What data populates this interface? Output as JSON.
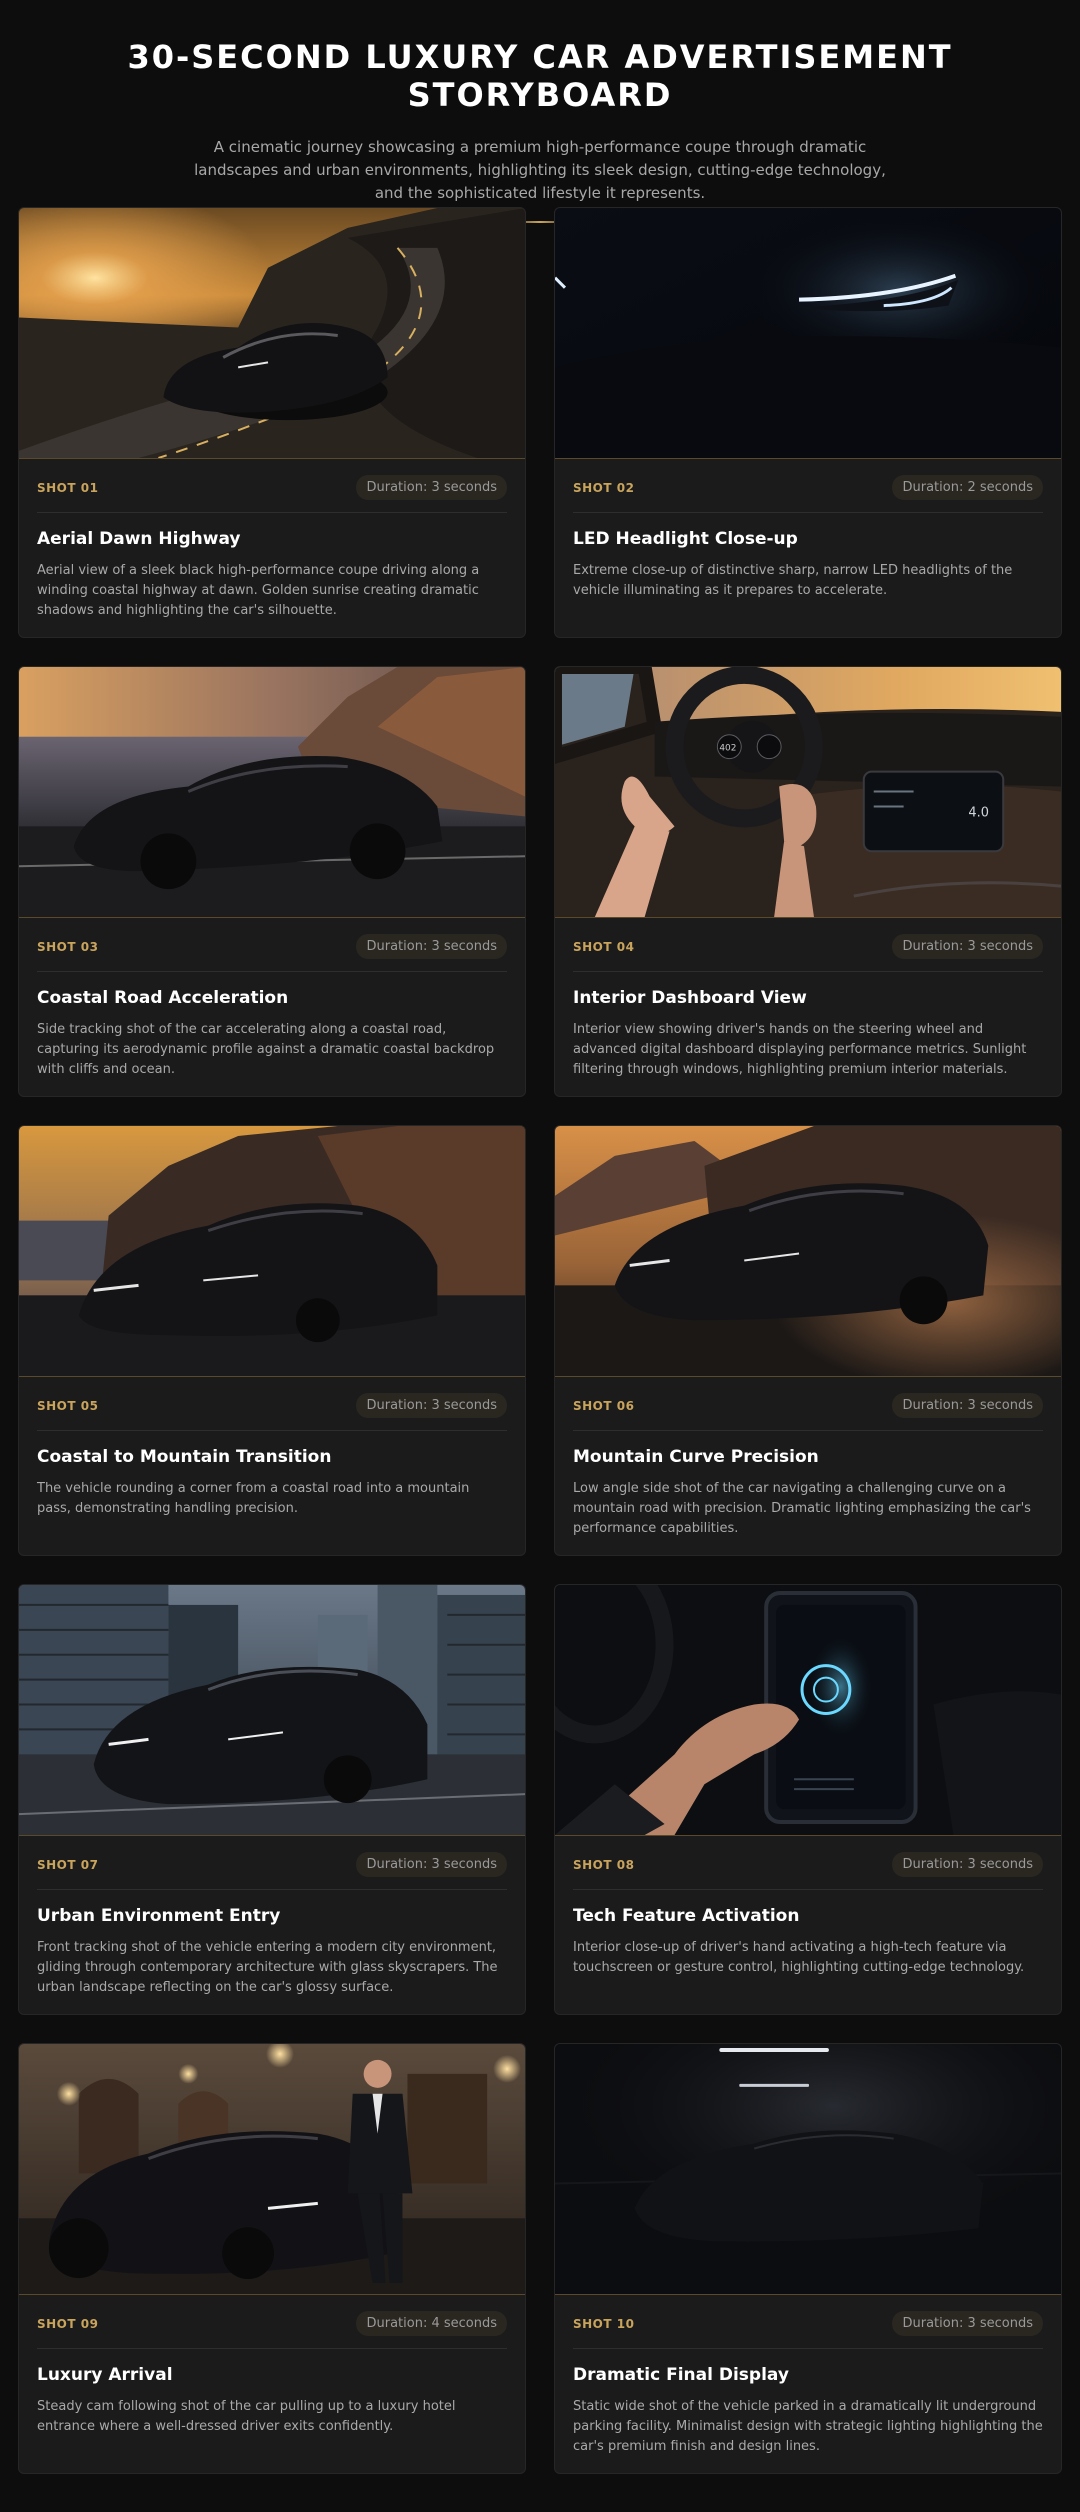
{
  "header": {
    "title": "30-SECOND LUXURY CAR ADVERTISEMENT STORYBOARD",
    "subtitle": "A cinematic journey showcasing a premium high-performance coupe through dramatic landscapes and urban environments, highlighting its sleek design, cutting-edge technology, and the sophisticated lifestyle it represents."
  },
  "colors": {
    "accent": "#c9a45c",
    "background": "#0d0d0d",
    "card": "#1b1b1b"
  },
  "shots": [
    {
      "number": "SHOT 01",
      "duration": "Duration: 3 seconds",
      "title": "Aerial Dawn Highway",
      "description": "Aerial view of a sleek black high-performance coupe driving along a winding coastal highway at dawn. Golden sunrise creating dramatic shadows and highlighting the car's silhouette."
    },
    {
      "number": "SHOT 02",
      "duration": "Duration: 2 seconds",
      "title": "LED Headlight Close-up",
      "description": "Extreme close-up of distinctive sharp, narrow LED headlights of the vehicle illuminating as it prepares to accelerate."
    },
    {
      "number": "SHOT 03",
      "duration": "Duration: 3 seconds",
      "title": "Coastal Road Acceleration",
      "description": "Side tracking shot of the car accelerating along a coastal road, capturing its aerodynamic profile against a dramatic coastal backdrop with cliffs and ocean."
    },
    {
      "number": "SHOT 04",
      "duration": "Duration: 3 seconds",
      "title": "Interior Dashboard View",
      "description": "Interior view showing driver's hands on the steering wheel and advanced digital dashboard displaying performance metrics. Sunlight filtering through windows, highlighting premium interior materials.",
      "dash_speed": "402",
      "dash_screen": "4.0"
    },
    {
      "number": "SHOT 05",
      "duration": "Duration: 3 seconds",
      "title": "Coastal to Mountain Transition",
      "description": "The vehicle rounding a corner from a coastal road into a mountain pass, demonstrating handling precision."
    },
    {
      "number": "SHOT 06",
      "duration": "Duration: 3 seconds",
      "title": "Mountain Curve Precision",
      "description": "Low angle side shot of the car navigating a challenging curve on a mountain road with precision. Dramatic lighting emphasizing the car's performance capabilities."
    },
    {
      "number": "SHOT 07",
      "duration": "Duration: 3 seconds",
      "title": "Urban Environment Entry",
      "description": "Front tracking shot of the vehicle entering a modern city environment, gliding through contemporary architecture with glass skyscrapers. The urban landscape reflecting on the car's glossy surface."
    },
    {
      "number": "SHOT 08",
      "duration": "Duration: 3 seconds",
      "title": "Tech Feature Activation",
      "description": "Interior close-up of driver's hand activating a high-tech feature via touchscreen or gesture control, highlighting cutting-edge technology."
    },
    {
      "number": "SHOT 09",
      "duration": "Duration: 4 seconds",
      "title": "Luxury Arrival",
      "description": "Steady cam following shot of the car pulling up to a luxury hotel entrance where a well-dressed driver exits confidently."
    },
    {
      "number": "SHOT 10",
      "duration": "Duration: 3 seconds",
      "title": "Dramatic Final Display",
      "description": "Static wide shot of the vehicle parked in a dramatically lit underground parking facility. Minimalist design with strategic lighting highlighting the car's premium finish and design lines."
    }
  ]
}
